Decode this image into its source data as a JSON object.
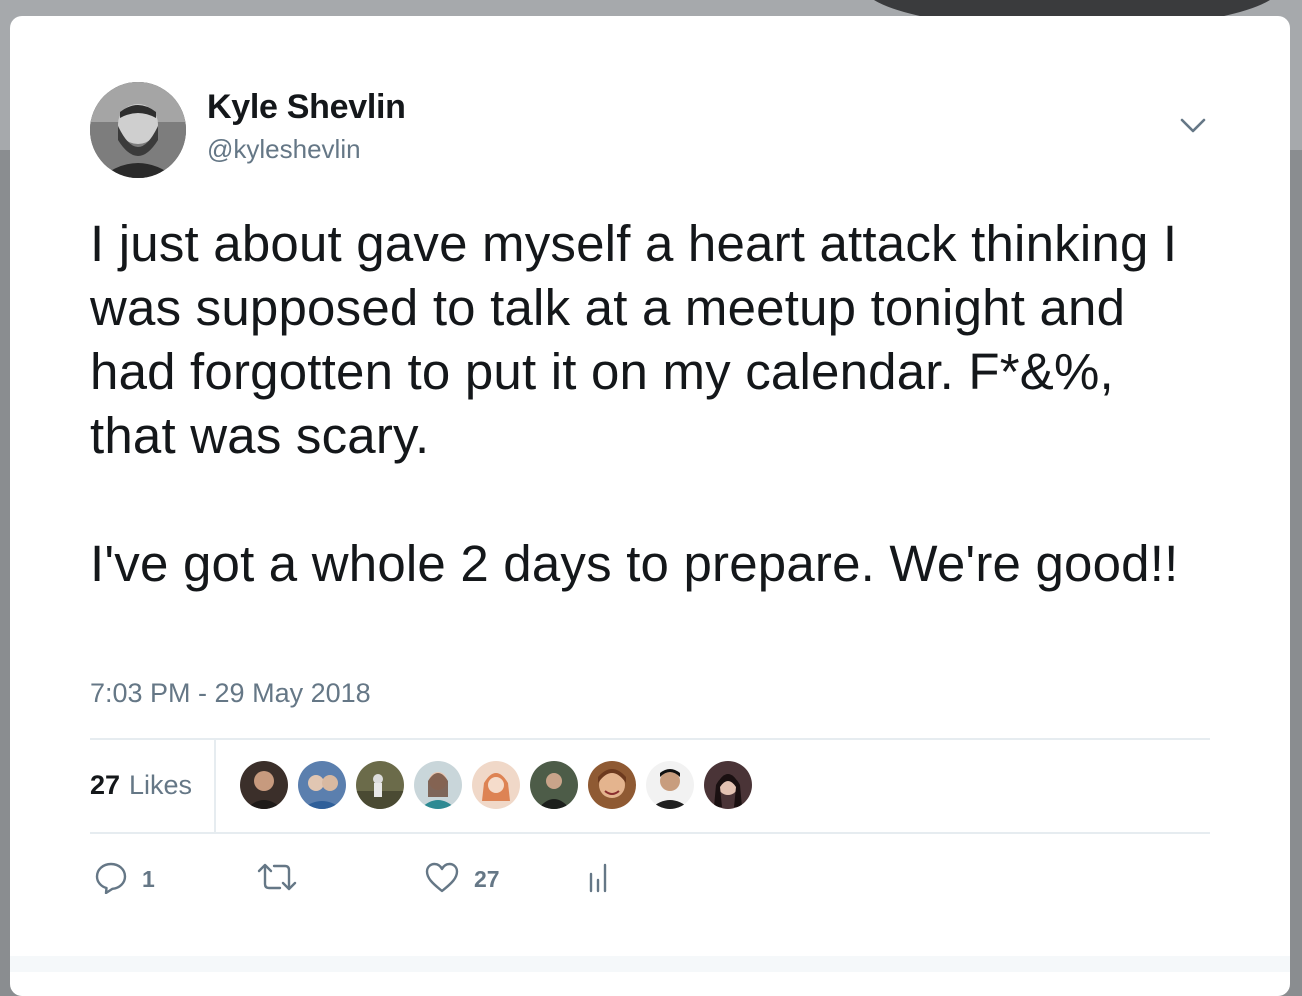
{
  "tweet": {
    "author_name": "Kyle Shevlin",
    "author_handle": "@kyleshevlin",
    "text": "I just about gave myself a heart attack thinking I was supposed to talk at a meetup tonight and had forgotten to put it on my calendar. F*&%, that was scary.\n\nI've got a whole 2 days to prepare. We're good!!",
    "timestamp": "7:03 PM - 29 May 2018"
  },
  "stats": {
    "likes_count": "27",
    "likes_label": "Likes"
  },
  "likers": [
    {
      "name": "liker-1",
      "color": "#3b2f2a"
    },
    {
      "name": "liker-2",
      "color": "#5b7fae"
    },
    {
      "name": "liker-3",
      "color": "#6b6b4a"
    },
    {
      "name": "liker-4",
      "color": "#9fb2b8"
    },
    {
      "name": "liker-5",
      "color": "#d98a6a"
    },
    {
      "name": "liker-6",
      "color": "#2d3a2c"
    },
    {
      "name": "liker-7",
      "color": "#b0683f"
    },
    {
      "name": "liker-8",
      "color": "#2a2a2a"
    },
    {
      "name": "liker-9",
      "color": "#4a3437"
    }
  ],
  "actions": {
    "reply_count": "1",
    "retweet_count": "",
    "like_count": "27",
    "icons": [
      "reply-icon",
      "retweet-icon",
      "heart-icon",
      "analytics-icon"
    ]
  },
  "colors": {
    "text_primary": "#14171a",
    "text_secondary": "#657786",
    "divider": "#e6ecf0"
  }
}
